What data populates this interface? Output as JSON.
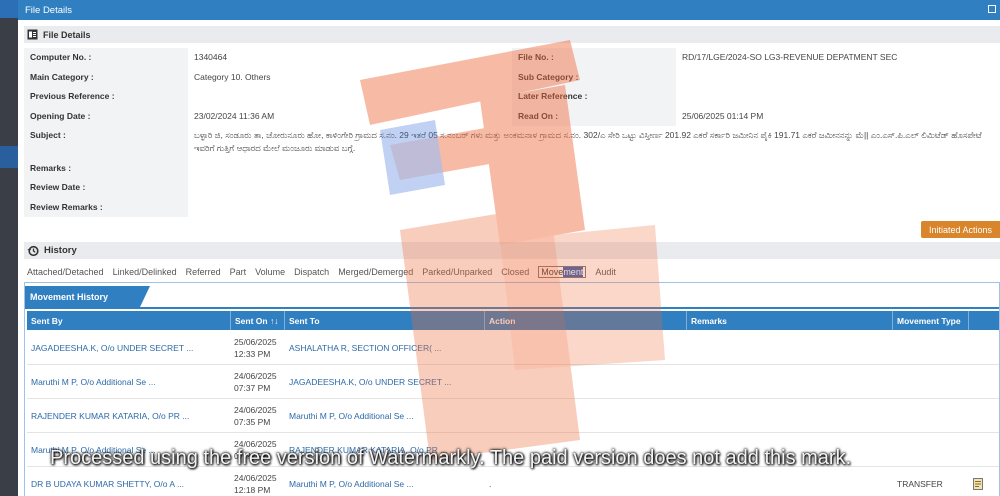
{
  "window": {
    "title": "File Details"
  },
  "file_details": {
    "heading": "File Details",
    "rows": [
      {
        "label": "Computer No. :",
        "value": "1340464",
        "label2": "File No. :",
        "value2": "RD/17/LGE/2024-SO LG3-REVENUE DEPATMENT SEC"
      },
      {
        "label": "Main Category :",
        "value": "Category 10. Others",
        "label2": "Sub Category :",
        "value2": ""
      },
      {
        "label": "Previous Reference :",
        "value": "",
        "label2": "Later Reference :",
        "value2": ""
      },
      {
        "label": "Opening Date :",
        "value": "23/02/2024 11:36 AM",
        "label2": "Read On :",
        "value2": "25/06/2025 01:14 PM"
      }
    ],
    "subject_label": "Subject :",
    "subject_value": "ಬಳ್ಳಾರಿ ಜಿ, ಸಂಡೂರು ತಾ, ಚೋರುನೂರು ಹೋ, ಕಾಳಿಂಗೇರಿ ಗ್ರಾಮದ ಸ.ನಂ. 29 ಇತರೆ 05 ಸ.ನಂಬರ್ ಗಳು ಮತ್ತು ಅಂಕಮನಾಳ ಗ್ರಾಮದ ಸ.ನಂ. 302/ಎ ಸೇರಿ ಒಟ್ಟು ವಿಸ್ತೀರ್ಣ 201.92 ಎಕರೆ ಸರ್ಕಾರಿ ಜಮೀನಿನ ಪೈಕಿ 191.71 ಎಕರೆ ಜಮೀನನನ್ನು ಮೆ|| ಎಂ.ಎಸ್.ಪಿ.ಎಲ್ ಲಿಮಿಟೆಡ್ ಹೊಸಪೇಟೆ ಇವರಿಗೆ ಗುತ್ತಿಗೆ ಆಧಾರದ ಮೇಲೆ ಮಂಜೂರು ಮಾಡುವ ಬಗ್ಗೆ.",
    "remarks_label": "Remarks :",
    "review_date_label": "Review Date :",
    "review_remarks_label": "Review Remarks :"
  },
  "initiated_actions_label": "Initiated Actions",
  "history": {
    "heading": "History",
    "tabs": [
      "Attached/Detached",
      "Linked/Delinked",
      "Referred",
      "Part",
      "Volume",
      "Dispatch",
      "Merged/Demerged",
      "Parked/Unparked",
      "Closed",
      "Movement",
      "Audit"
    ],
    "active_tab_prefix": "Move",
    "active_tab_highlight": "ment"
  },
  "movement_history": {
    "title": "Movement History",
    "columns": [
      "Sent By",
      "Sent On ↑↓",
      "Sent To",
      "Action",
      "Remarks",
      "Movement Type",
      ""
    ],
    "rows": [
      {
        "sent_by": "JAGADEESHA.K, O/o UNDER SECRET ...",
        "date": "25/06/2025",
        "time": "12:33 PM",
        "sent_to": "ASHALATHA R, SECTION OFFICER( ...",
        "action": "",
        "remarks": "",
        "type": ""
      },
      {
        "sent_by": "Maruthi M P, O/o Additional Se ...",
        "date": "24/06/2025",
        "time": "07:37 PM",
        "sent_to": "JAGADEESHA.K, O/o UNDER SECRET ...",
        "action": "",
        "remarks": "",
        "type": ""
      },
      {
        "sent_by": "RAJENDER KUMAR KATARIA, O/o PR ...",
        "date": "24/06/2025",
        "time": "07:35 PM",
        "sent_to": "Maruthi M P, O/o Additional Se ...",
        "action": "",
        "remarks": "",
        "type": ""
      },
      {
        "sent_by": "Maruthi M P, O/o Additional Se ...",
        "date": "24/06/2025",
        "time": "07:?? PM",
        "sent_to": "RAJENDER KUMAR KATARIA, O/o PR ...",
        "action": "",
        "remarks": "",
        "type": ""
      },
      {
        "sent_by": "DR B UDAYA KUMAR SHETTY, O/o A ...",
        "date": "24/06/2025",
        "time": "12:18 PM",
        "sent_to": "Maruthi M P, O/o Additional Se ...",
        "action": ".",
        "remarks": "",
        "type": "TRANSFER"
      }
    ]
  },
  "watermark_text": "Processed using the free version of Watermarkly. The paid version does not add this mark.",
  "colors": {
    "primary": "#2f7fc1",
    "accent_orange": "#d9852b",
    "link": "#2c6aa8"
  }
}
